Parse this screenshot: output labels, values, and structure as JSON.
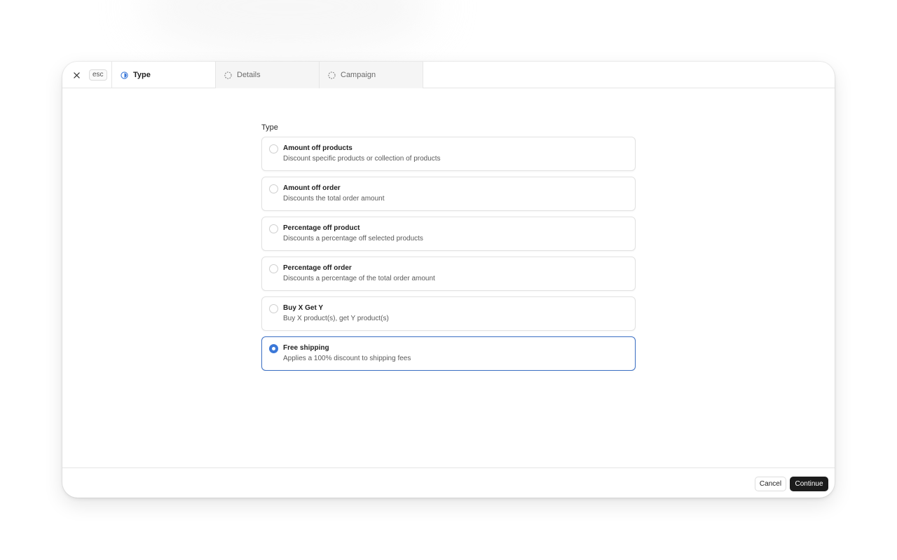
{
  "header": {
    "esc_label": "esc",
    "tabs": [
      {
        "label": "Type",
        "state": "active",
        "icon": "half-circle-progress-icon"
      },
      {
        "label": "Details",
        "state": "pending",
        "icon": "dashed-circle-icon"
      },
      {
        "label": "Campaign",
        "state": "pending",
        "icon": "dashed-circle-icon"
      }
    ]
  },
  "form": {
    "section_label": "Type",
    "options": [
      {
        "title": "Amount off products",
        "description": "Discount specific products or collection of products",
        "selected": false
      },
      {
        "title": "Amount off order",
        "description": "Discounts the total order amount",
        "selected": false
      },
      {
        "title": "Percentage off product",
        "description": "Discounts a percentage off selected products",
        "selected": false
      },
      {
        "title": "Percentage off order",
        "description": "Discounts a percentage of the total order amount",
        "selected": false
      },
      {
        "title": "Buy X Get Y",
        "description": "Buy X product(s), get Y product(s)",
        "selected": false
      },
      {
        "title": "Free shipping",
        "description": "Applies a 100% discount to shipping fees",
        "selected": true
      }
    ]
  },
  "footer": {
    "cancel_label": "Cancel",
    "continue_label": "Continue"
  },
  "colors": {
    "accent": "#3b78d8",
    "primary_button": "#1c1c1c"
  }
}
